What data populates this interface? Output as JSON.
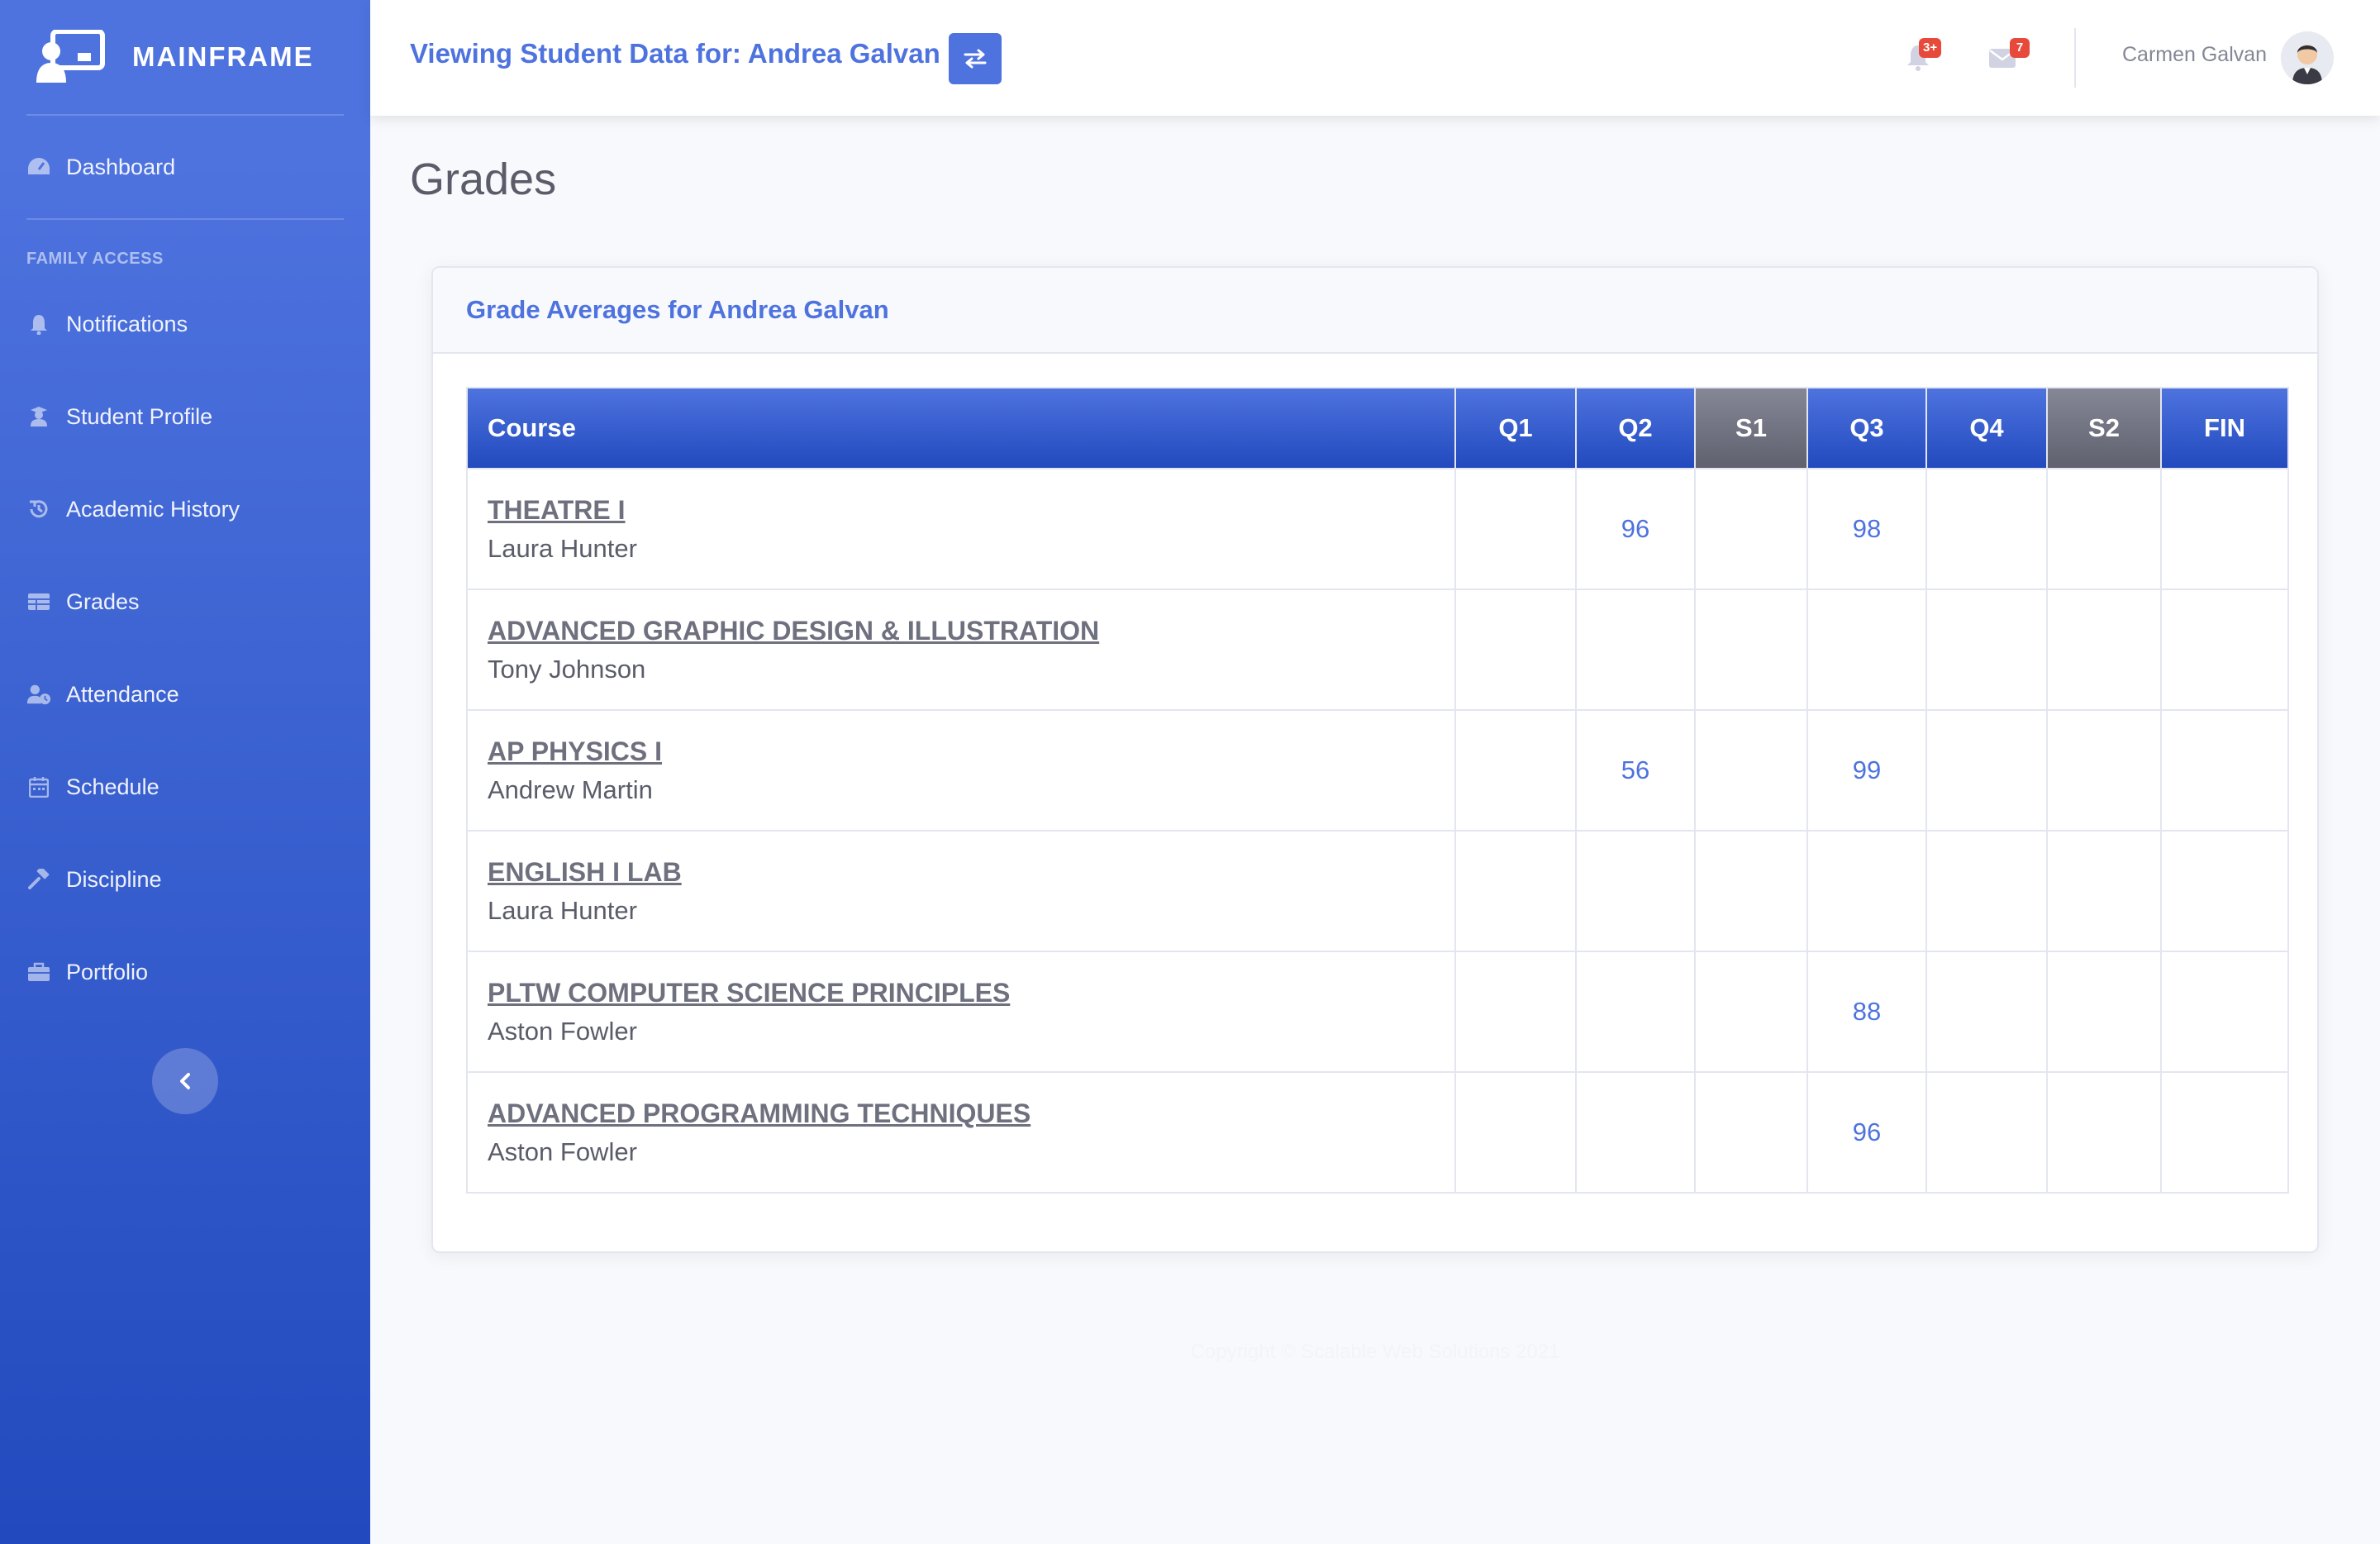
{
  "brand": {
    "name": "MAINFRAME"
  },
  "sidebar": {
    "dashboard": {
      "label": "Dashboard",
      "icon": "tachometer-icon"
    },
    "section_heading": "FAMILY ACCESS",
    "items": [
      {
        "label": "Notifications",
        "icon": "bell-icon"
      },
      {
        "label": "Student Profile",
        "icon": "graduate-icon"
      },
      {
        "label": "Academic History",
        "icon": "history-icon"
      },
      {
        "label": "Grades",
        "icon": "table-icon"
      },
      {
        "label": "Attendance",
        "icon": "user-clock-icon"
      },
      {
        "label": "Schedule",
        "icon": "calendar-icon"
      },
      {
        "label": "Discipline",
        "icon": "gavel-icon"
      },
      {
        "label": "Portfolio",
        "icon": "briefcase-icon"
      }
    ],
    "collapse_icon": "chevron-left-icon"
  },
  "topbar": {
    "viewing_label": "Viewing Student Data for: Andrea Galvan",
    "switch_icon": "exchange-icon",
    "alerts_badge": "3+",
    "messages_badge": "7",
    "user_name": "Carmen Galvan"
  },
  "page": {
    "title": "Grades"
  },
  "card": {
    "title": "Grade Averages for Andrea Galvan"
  },
  "grades_table": {
    "headers": [
      "Course",
      "Q1",
      "Q2",
      "S1",
      "Q3",
      "Q4",
      "S2",
      "FIN"
    ],
    "rows": [
      {
        "course": "THEATRE I",
        "teacher": "Laura Hunter",
        "q1": "",
        "q2": "96",
        "s1": "",
        "q3": "98",
        "q4": "",
        "s2": "",
        "fin": ""
      },
      {
        "course": "ADVANCED GRAPHIC DESIGN & ILLUSTRATION",
        "teacher": "Tony Johnson",
        "q1": "",
        "q2": "",
        "s1": "",
        "q3": "",
        "q4": "",
        "s2": "",
        "fin": ""
      },
      {
        "course": "AP PHYSICS I",
        "teacher": "Andrew Martin",
        "q1": "",
        "q2": "56",
        "s1": "",
        "q3": "99",
        "q4": "",
        "s2": "",
        "fin": ""
      },
      {
        "course": "ENGLISH I LAB",
        "teacher": "Laura Hunter",
        "q1": "",
        "q2": "",
        "s1": "",
        "q3": "",
        "q4": "",
        "s2": "",
        "fin": ""
      },
      {
        "course": "PLTW COMPUTER SCIENCE PRINCIPLES",
        "teacher": "Aston Fowler",
        "q1": "",
        "q2": "",
        "s1": "",
        "q3": "88",
        "q4": "",
        "s2": "",
        "fin": ""
      },
      {
        "course": "ADVANCED PROGRAMMING TECHNIQUES",
        "teacher": "Aston Fowler",
        "q1": "",
        "q2": "",
        "s1": "",
        "q3": "96",
        "q4": "",
        "s2": "",
        "fin": ""
      }
    ]
  },
  "footer": {
    "text": "Copyright © Scalable Web Solutions 2021"
  },
  "colors": {
    "primary": "#4e73df",
    "primary_dark": "#224abe",
    "semester_gray": "#858796",
    "badge_red": "#e74a3b"
  }
}
